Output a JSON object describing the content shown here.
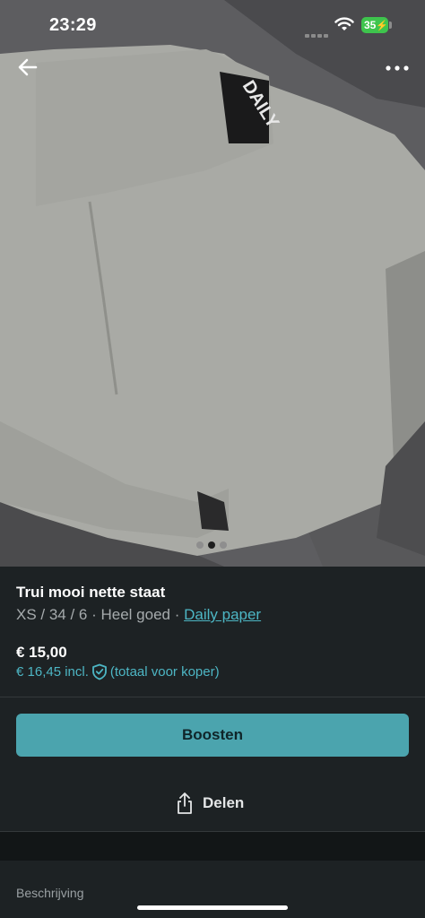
{
  "status_bar": {
    "time": "23:29",
    "battery": "35"
  },
  "photo": {
    "sleeve_text": "DAILY",
    "page_count": 3,
    "active_index": 1
  },
  "icons": {
    "back": "arrow-left-icon",
    "more": "more-horizontal-icon",
    "shield": "shield-check-icon",
    "share": "share-icon"
  },
  "item": {
    "title": "Trui mooi nette staat",
    "size_condition": "XS / 34 / 6 · Heel goed · ",
    "brand": "Daily paper",
    "price": "€ 15,00",
    "price_incl": "€ 16,45 incl.",
    "buyer_total_note": "(totaal voor koper)"
  },
  "actions": {
    "boost_label": "Boosten",
    "share_label": "Delen"
  },
  "description": {
    "label": "Beschrijving"
  },
  "colors": {
    "background": "#1d2224",
    "accent": "#4db6c4",
    "button": "#4ba4ae"
  }
}
